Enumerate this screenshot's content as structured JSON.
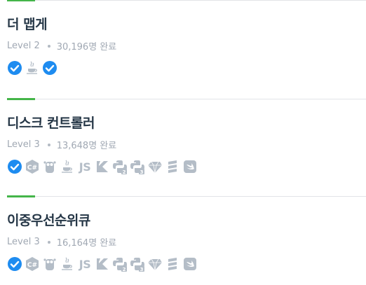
{
  "problems": [
    {
      "title": "더 맵게",
      "level": "Level 2",
      "solved": "30,196명 완료",
      "languages": [
        "check-icon",
        "java-icon",
        "check-icon"
      ]
    },
    {
      "title": "디스크 컨트롤러",
      "level": "Level 3",
      "solved": "13,648명 완료",
      "languages": [
        "check-icon",
        "csharp-icon",
        "go-icon",
        "java-icon",
        "javascript-icon",
        "kotlin-icon",
        "python2-icon",
        "python3-icon",
        "ruby-icon",
        "scala-icon",
        "swift-icon"
      ]
    },
    {
      "title": "이중우선순위큐",
      "level": "Level 3",
      "solved": "16,164명 완료",
      "languages": [
        "check-icon",
        "csharp-icon",
        "go-icon",
        "java-icon",
        "javascript-icon",
        "kotlin-icon",
        "python2-icon",
        "python3-icon",
        "ruby-icon",
        "scala-icon",
        "swift-icon"
      ]
    }
  ],
  "labels": {
    "javascript": "JS"
  },
  "colors": {
    "accent": "#44b549",
    "check": "#1e8cf0",
    "icon_gray": "#b4bdc7",
    "title": "#263747",
    "meta": "#a0a8b3"
  }
}
